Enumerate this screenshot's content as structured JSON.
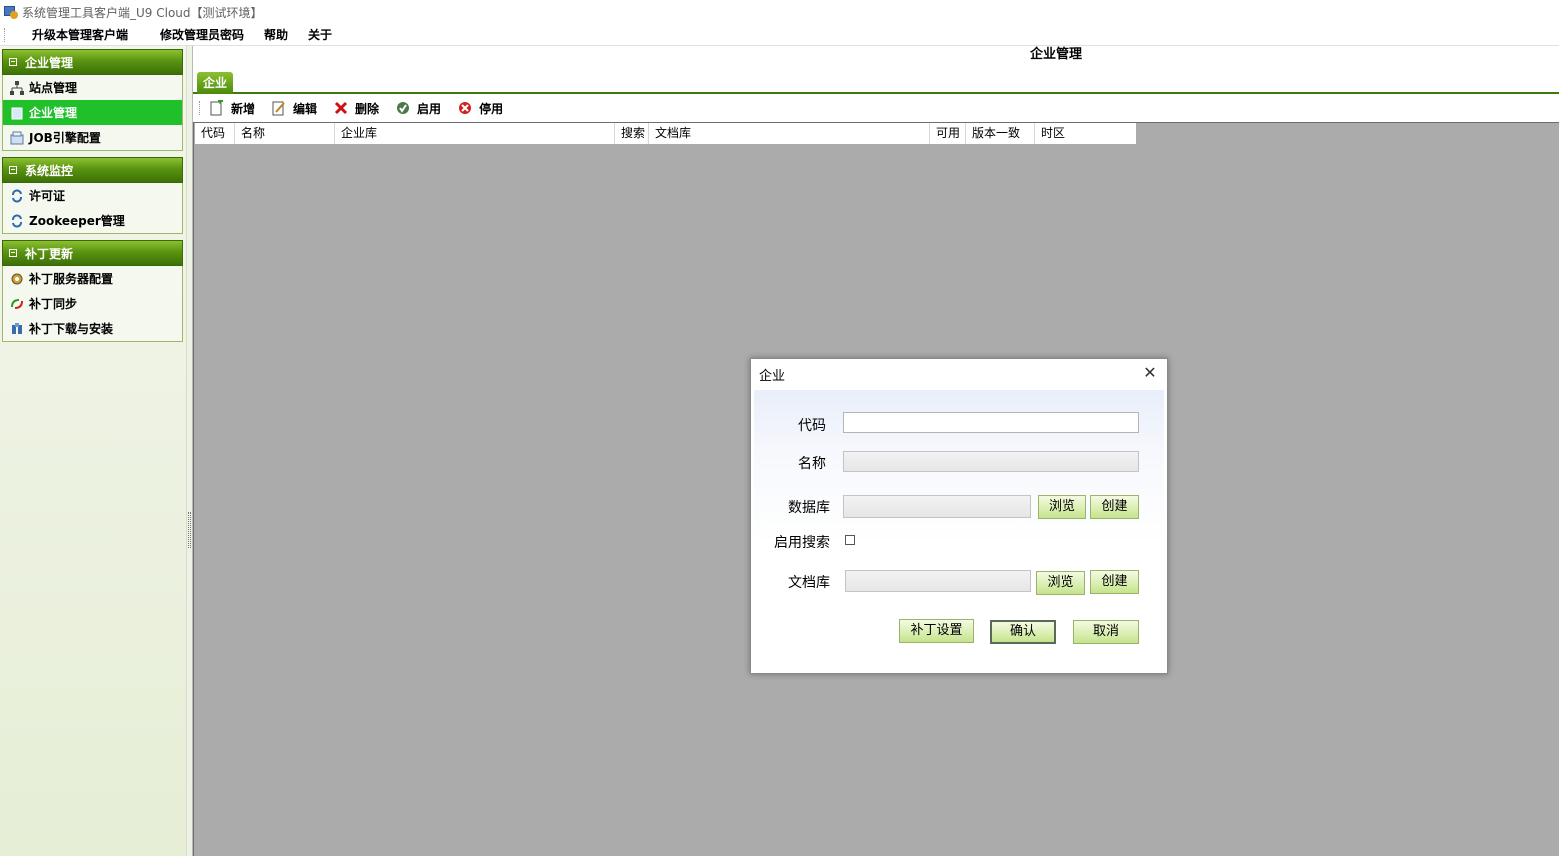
{
  "window": {
    "title": "系统管理工具客户端_U9 Cloud【测试环境】"
  },
  "menu": {
    "items": [
      {
        "label": "升级本管理客户端"
      },
      {
        "label": "修改管理员密码"
      },
      {
        "label": "帮助"
      },
      {
        "label": "关于"
      }
    ]
  },
  "sidebar": {
    "groups": [
      {
        "title": "企业管理",
        "items": [
          {
            "label": "站点管理",
            "icon": "site-tree-icon"
          },
          {
            "label": "企业管理",
            "icon": "enterprise-icon",
            "active": true
          },
          {
            "label": "JOB引擎配置",
            "icon": "job-config-icon"
          }
        ]
      },
      {
        "title": "系统监控",
        "items": [
          {
            "label": "许可证",
            "icon": "refresh-icon"
          },
          {
            "label": "Zookeeper管理",
            "icon": "refresh-icon"
          }
        ]
      },
      {
        "title": "补丁更新",
        "items": [
          {
            "label": "补丁服务器配置",
            "icon": "server-config-icon"
          },
          {
            "label": "补丁同步",
            "icon": "sync-icon"
          },
          {
            "label": "补丁下载与安装",
            "icon": "download-install-icon"
          }
        ]
      }
    ]
  },
  "main": {
    "title": "企业管理",
    "tab": "企业",
    "toolbar": {
      "add": "新增",
      "edit": "编辑",
      "delete": "删除",
      "enable": "启用",
      "disable": "停用"
    },
    "columns": [
      "代码",
      "名称",
      "企业库",
      "搜索",
      "文档库",
      "可用",
      "版本一致",
      "时区"
    ]
  },
  "dialog": {
    "title": "企业",
    "code_label": "代码",
    "code_value": "",
    "name_label": "名称",
    "name_value": "",
    "db_label": "数据库",
    "db_value": "",
    "browse": "浏览",
    "create": "创建",
    "search_label": "启用搜索",
    "search_checked": false,
    "docdb_label": "文档库",
    "docdb_value": "",
    "patch_settings": "补丁设置",
    "confirm": "确认",
    "cancel": "取消"
  },
  "colors": {
    "accent_green": "#3d7008",
    "active_item": "#1fc02a",
    "grid_background": "#ababab"
  }
}
